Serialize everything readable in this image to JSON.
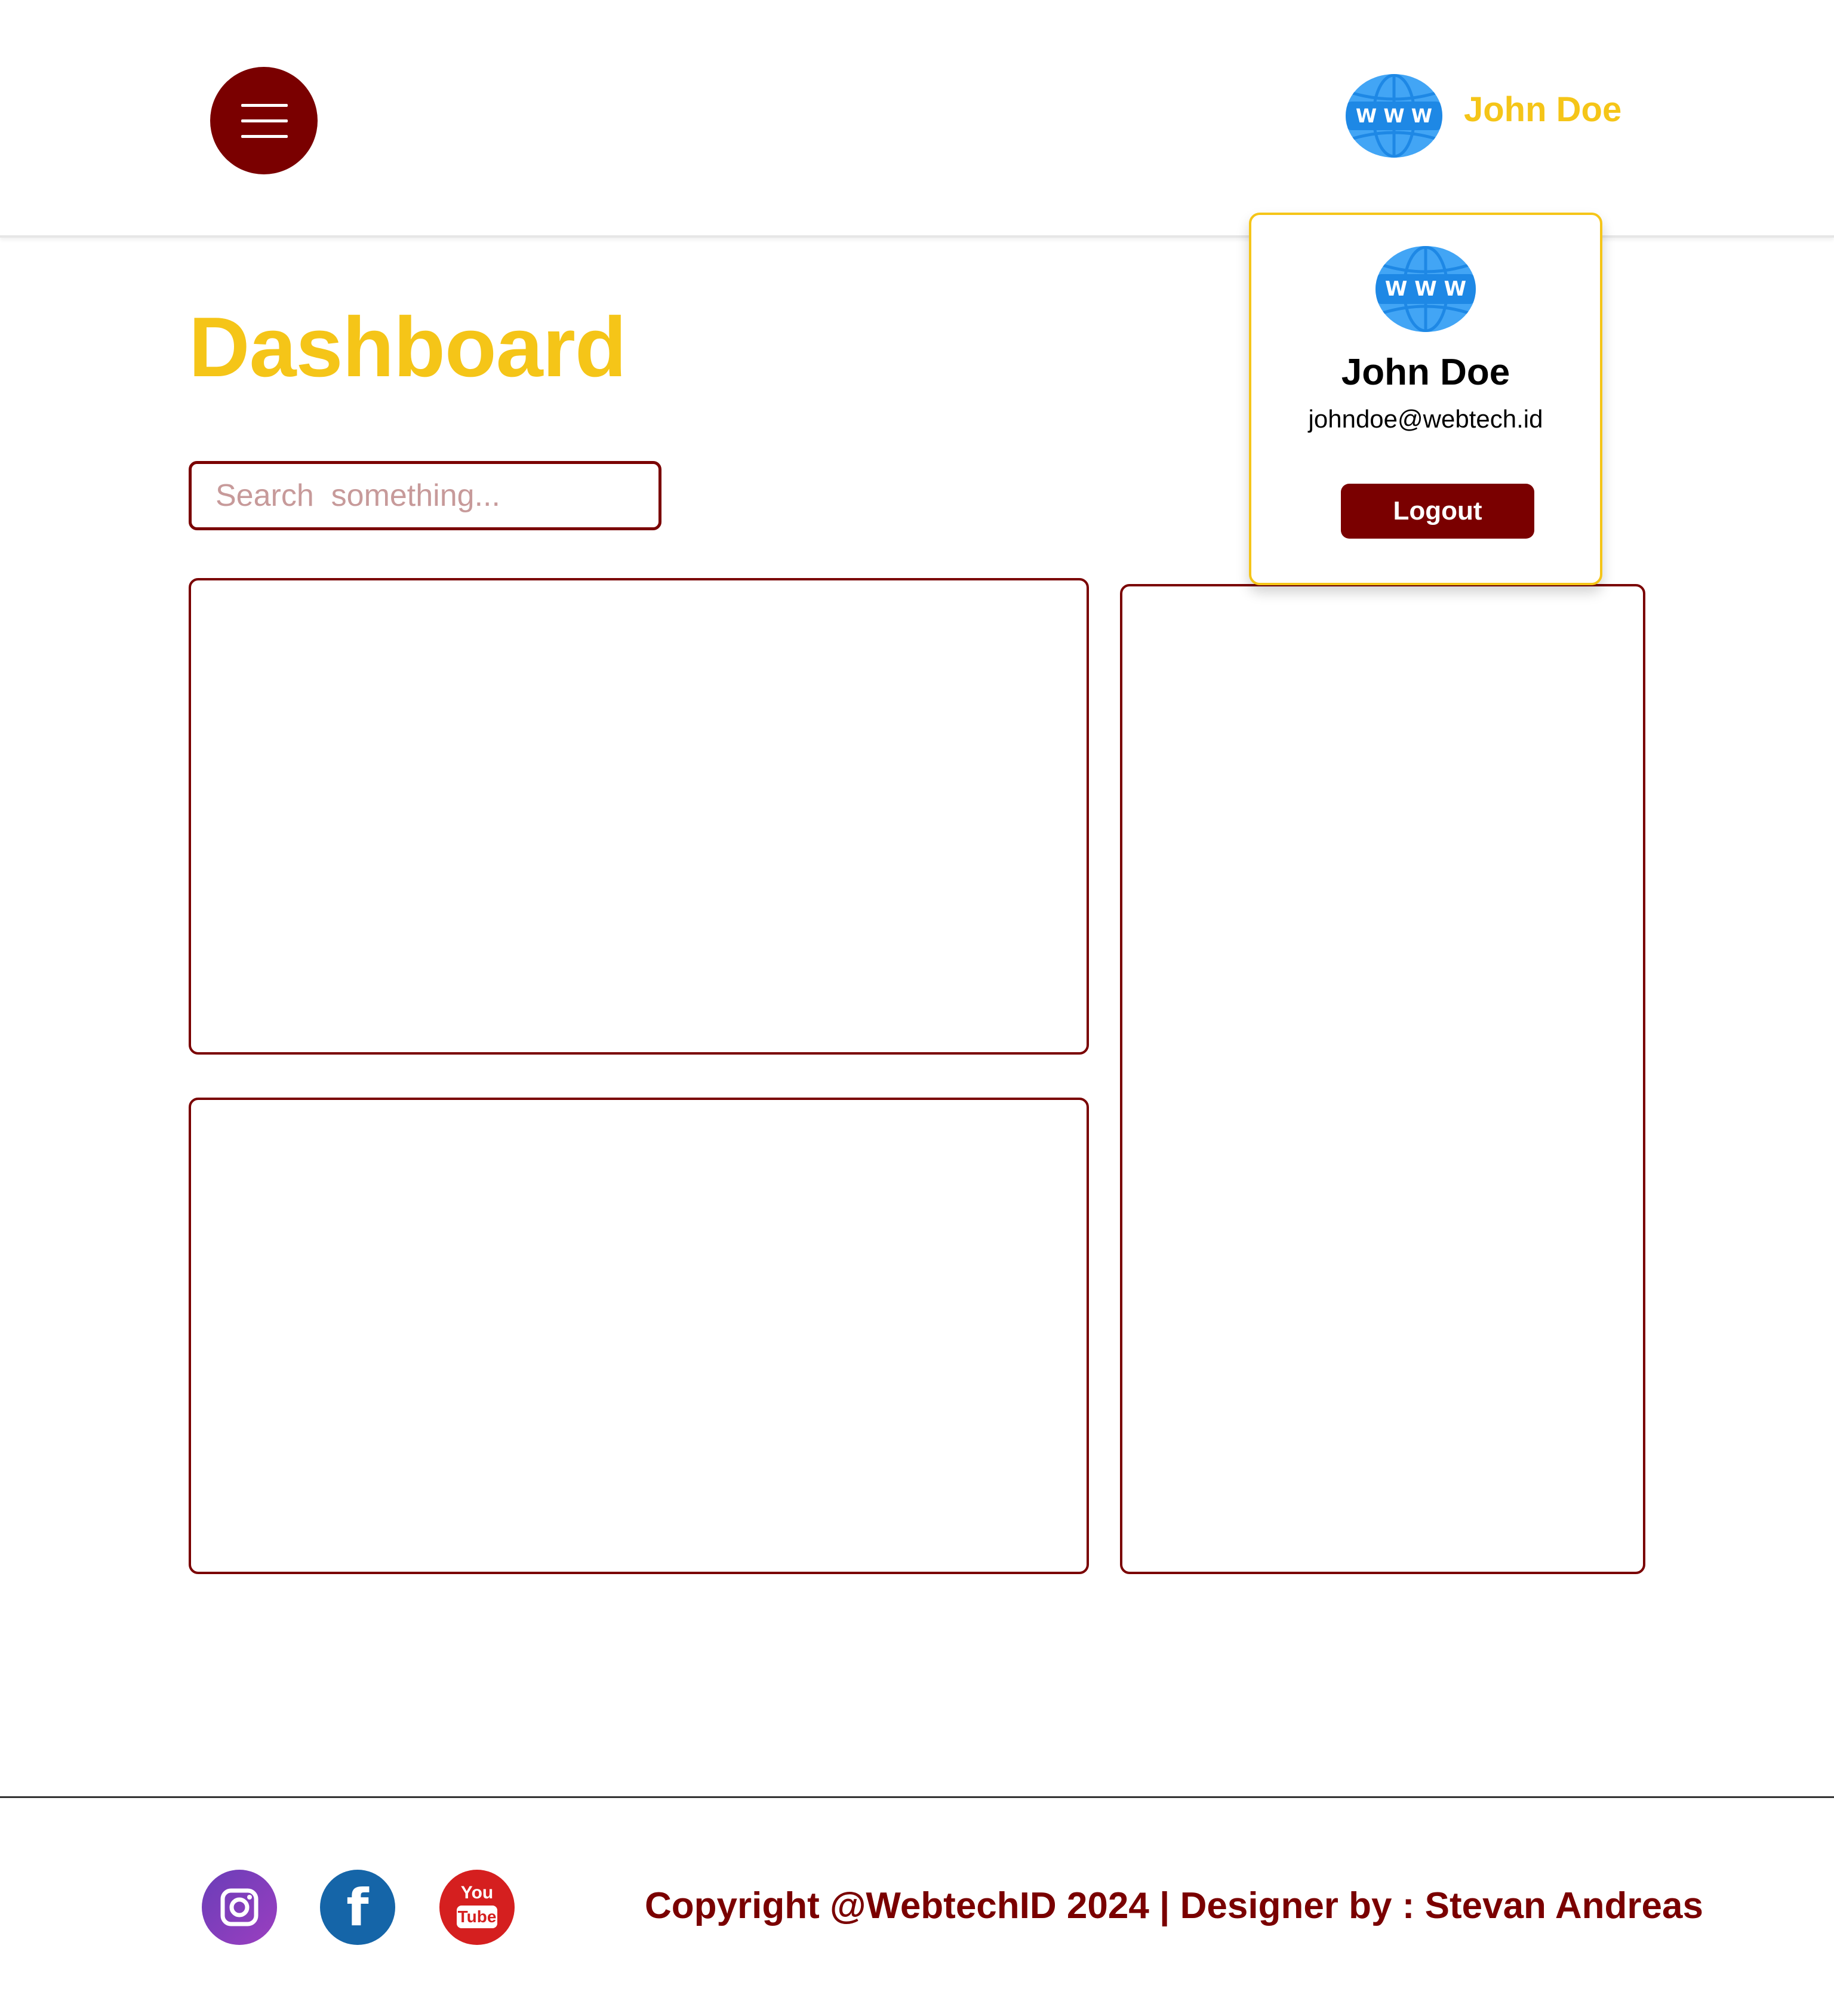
{
  "header": {
    "menu_icon": "hamburger-menu-icon",
    "avatar_icon": "www-globe-icon",
    "avatar_band_text": "W W W",
    "user_name": "John Doe"
  },
  "main": {
    "title": "Dashboard",
    "search_placeholder": "Search  something..."
  },
  "profile_dropdown": {
    "avatar_icon": "www-globe-icon",
    "avatar_band_text": "W W W",
    "name": "John Doe",
    "email": "johndoe@webtech.id",
    "logout_label": "Logout"
  },
  "footer": {
    "social": [
      {
        "icon": "instagram-icon"
      },
      {
        "icon": "facebook-icon",
        "glyph": "f"
      },
      {
        "icon": "youtube-icon",
        "top_text": "You",
        "bottom_text": "Tube"
      }
    ],
    "copyright": "Copyright @WebtechID 2024 | Designer by : Stevan Andreas"
  },
  "colors": {
    "brand_dark_red": "#7a0000",
    "accent_yellow": "#f5c518",
    "globe_blue": "#42a5f5",
    "instagram": "#7b3bbf",
    "facebook": "#1565a8",
    "youtube": "#d51f1f"
  }
}
